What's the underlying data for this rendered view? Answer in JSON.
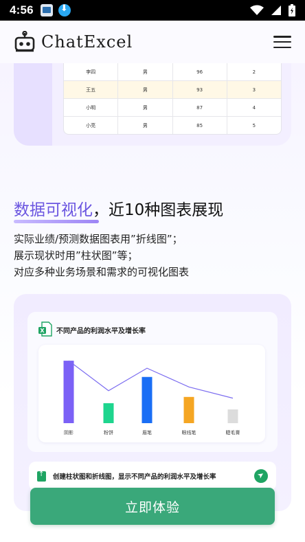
{
  "status_bar": {
    "time": "4:56",
    "icons": [
      "app-icon",
      "download-icon",
      "wifi-icon",
      "cellular-icon",
      "battery-icon"
    ]
  },
  "header": {
    "logo_text": "ChatExcel",
    "logo_icon": "robot-icon",
    "menu_icon": "hamburger-menu-icon"
  },
  "table": {
    "rows": [
      {
        "name": "李四",
        "gender": "男",
        "score": "96",
        "rank": "2",
        "highlight": false
      },
      {
        "name": "王五",
        "gender": "男",
        "score": "93",
        "rank": "3",
        "highlight": true
      },
      {
        "name": "小明",
        "gender": "男",
        "score": "87",
        "rank": "4",
        "highlight": false
      },
      {
        "name": "小亮",
        "gender": "男",
        "score": "85",
        "rank": "5",
        "highlight": false
      }
    ]
  },
  "section": {
    "heading_accent": "数据可视化",
    "heading_rest": "，近10种图表展现",
    "desc_lines": [
      "实际业绩/预测数据图表用”折线图”；",
      "展示现状时用”柱状图”等；",
      "对应多种业务场景和需求的可视化图表"
    ]
  },
  "demo": {
    "chart_title": "不同产品的利润水平及增长率",
    "prompt_text": "创建柱状图和折线图，显示不同产品的利润水平及增长率",
    "send_icon": "send-icon",
    "excel_icon": "excel-file-icon"
  },
  "chart_data": {
    "type": "bar",
    "title": "不同产品的利润水平及增长率",
    "categories": [
      "阴影",
      "粉饼",
      "眉笔",
      "眼线笔",
      "睫毛膏"
    ],
    "series": [
      {
        "type": "bar",
        "values": [
          100,
          32,
          74,
          42,
          22
        ]
      },
      {
        "type": "line",
        "values": [
          100,
          52,
          88,
          58,
          40
        ]
      }
    ],
    "bar_colors": [
      "#7b61f6",
      "#1ed58e",
      "#1a6ef5",
      "#f5a623",
      "#dcdcdc"
    ],
    "line_color": "#7b6cf0",
    "ylim": [
      0,
      110
    ],
    "grid": false
  },
  "cta": {
    "label": "立即体验"
  },
  "colors": {
    "accent": "#6b56e0",
    "cta": "#3aa87a",
    "highlight_row": "#fff8e6"
  }
}
